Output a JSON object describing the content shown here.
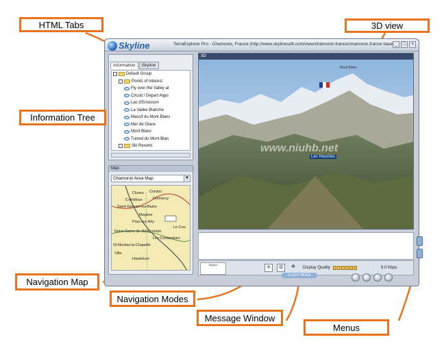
{
  "callouts": {
    "html_tabs": "HTML Tabs",
    "view_3d": "3D view",
    "info_tree": "Information Tree",
    "nav_map": "Navigation Map",
    "nav_modes": "Navigation Modes",
    "message_window": "Message Window",
    "menus": "Menus"
  },
  "app": {
    "logo": "Skyline",
    "window_title": "TerraExplorer Pro - Chamonix, France (http://www.skylinesoft.com/view/chamonix-france/chamonix-france base.fly)",
    "tabs": [
      "Information",
      "Skyline"
    ],
    "tree": [
      {
        "label": "Default Group",
        "icon": "folder-icon",
        "indent": 0
      },
      {
        "label": "Points of Interest",
        "icon": "folder-icon",
        "indent": 1
      },
      {
        "label": "Fly over the Valley at",
        "icon": "flyover-icon",
        "indent": 2
      },
      {
        "label": "Circuit / Depart Aigui",
        "icon": "eye-icon",
        "indent": 2
      },
      {
        "label": "Lac d'Emosson",
        "icon": "eye-icon",
        "indent": 2
      },
      {
        "label": "La Vallee Blanche",
        "icon": "eye-icon",
        "indent": 2
      },
      {
        "label": "Massif du Mont Blanc",
        "icon": "eye-icon",
        "indent": 2
      },
      {
        "label": "Mer de Glace",
        "icon": "eye-icon",
        "indent": 2
      },
      {
        "label": "Mont Blanc",
        "icon": "eye-icon",
        "indent": 2
      },
      {
        "label": "Tunnel du Mont Blan",
        "icon": "eye-icon",
        "indent": 2
      },
      {
        "label": "Ski Resorts",
        "icon": "folder-icon",
        "indent": 1
      }
    ],
    "map_title": "Map",
    "map_select": "Chamonix Area Map",
    "map_towns": [
      "Cluses",
      "Cordon",
      "Combloux",
      "Domancy",
      "Saint-Gervais-les-Bains",
      "Megève",
      "Praz-sur-Arly",
      "Le Cou",
      "Notre-Dame-de-Bellecombe",
      "Les Contamines",
      "St-Nicolas-la-Chapelle",
      "Hauteluce",
      "Villa"
    ],
    "view_title": "3D",
    "view_label_peak": "Mont Blanc",
    "view_label_town": "Les Houches",
    "watermark": "www.niuhb.net",
    "status": {
      "display_quality_label": "Display Quality",
      "fps_label": "9.0 Kbps",
      "logo_text": "Skyline",
      "pill_text": "FLIGHT MODE"
    }
  },
  "colors": {
    "callout_border": "#e8731f",
    "arrow": "#e8731f"
  }
}
